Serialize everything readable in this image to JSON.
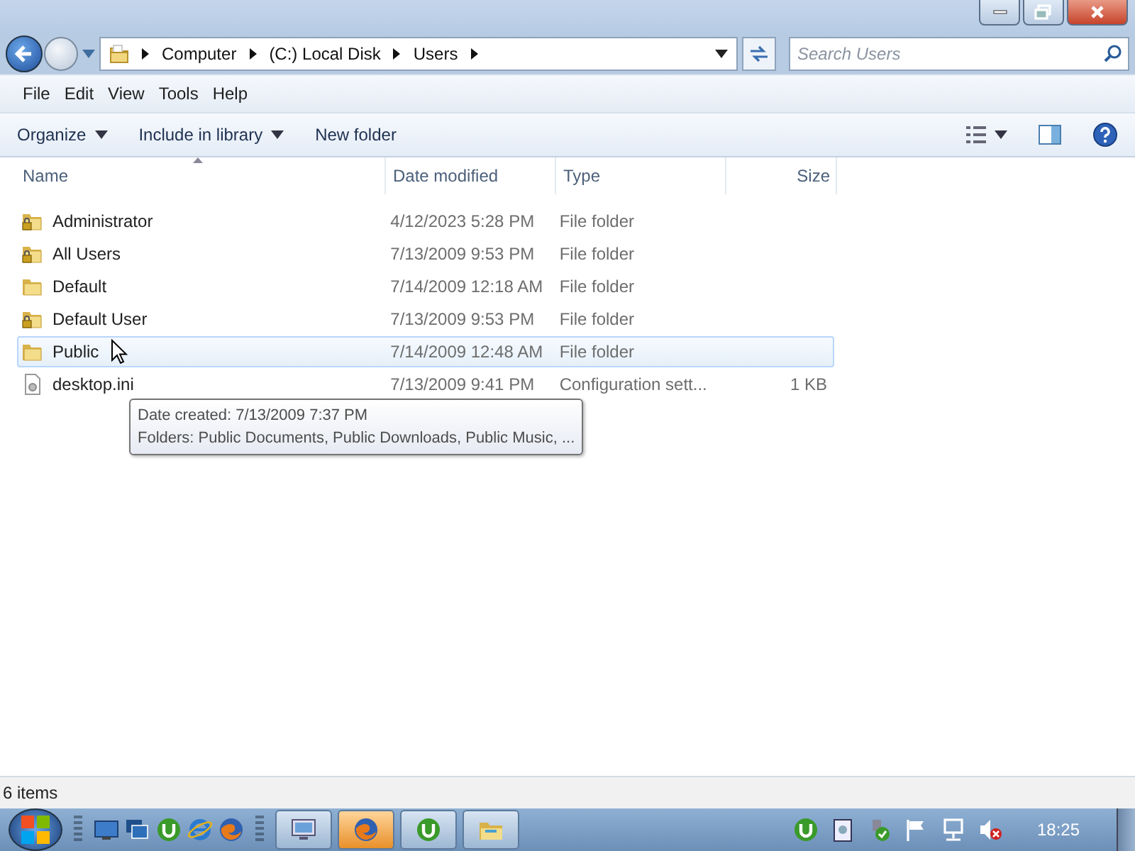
{
  "window": {
    "buttons": [
      {
        "kind": "minimize"
      },
      {
        "kind": "restore"
      },
      {
        "kind": "close"
      }
    ]
  },
  "address_bar": {
    "crumbs": [
      "Computer",
      "(C:) Local Disk",
      "Users"
    ]
  },
  "search": {
    "placeholder": "Search Users"
  },
  "menu": [
    "File",
    "Edit",
    "View",
    "Tools",
    "Help"
  ],
  "toolbar": [
    {
      "label": "Organize",
      "dropdown": true
    },
    {
      "label": "Include in library",
      "dropdown": true
    },
    {
      "label": "New folder",
      "dropdown": false
    }
  ],
  "columns": [
    "Name",
    "Date modified",
    "Type",
    "Size"
  ],
  "rows": [
    {
      "name": "Administrator",
      "date": "4/12/2023 5:28 PM",
      "type": "File folder",
      "size": "",
      "kind": "locked-folder",
      "hovered": false
    },
    {
      "name": "All Users",
      "date": "7/13/2009 9:53 PM",
      "type": "File folder",
      "size": "",
      "kind": "locked-folder",
      "hovered": false
    },
    {
      "name": "Default",
      "date": "7/14/2009 12:18 AM",
      "type": "File folder",
      "size": "",
      "kind": "folder",
      "hovered": false
    },
    {
      "name": "Default User",
      "date": "7/13/2009 9:53 PM",
      "type": "File folder",
      "size": "",
      "kind": "locked-folder",
      "hovered": false
    },
    {
      "name": "Public",
      "date": "7/14/2009 12:48 AM",
      "type": "File folder",
      "size": "",
      "kind": "folder",
      "hovered": true
    },
    {
      "name": "desktop.ini",
      "date": "7/13/2009 9:41 PM",
      "type": "Configuration sett...",
      "size": "1 KB",
      "kind": "file",
      "hovered": false
    }
  ],
  "tooltip": [
    "Date created: 7/13/2009 7:37 PM",
    "Folders: Public Documents, Public Downloads, Public Music, ..."
  ],
  "status_bar": "6 items",
  "taskbar": {
    "quick_launch": [
      {
        "kind": "desktop"
      },
      {
        "kind": "switch"
      },
      {
        "kind": "torrent"
      },
      {
        "kind": "browser-e"
      },
      {
        "kind": "browser-fox"
      }
    ],
    "tasks": [
      {
        "kind": "remote",
        "active": false
      },
      {
        "kind": "browser-fox",
        "active": true
      },
      {
        "kind": "torrent",
        "active": false
      },
      {
        "kind": "explorer",
        "active": false
      }
    ],
    "tray": [
      {
        "kind": "torrent"
      },
      {
        "kind": "clipboard"
      },
      {
        "kind": "shield"
      },
      {
        "kind": "flag"
      },
      {
        "kind": "network"
      },
      {
        "kind": "speaker-muted"
      }
    ],
    "clock": "18:25"
  }
}
